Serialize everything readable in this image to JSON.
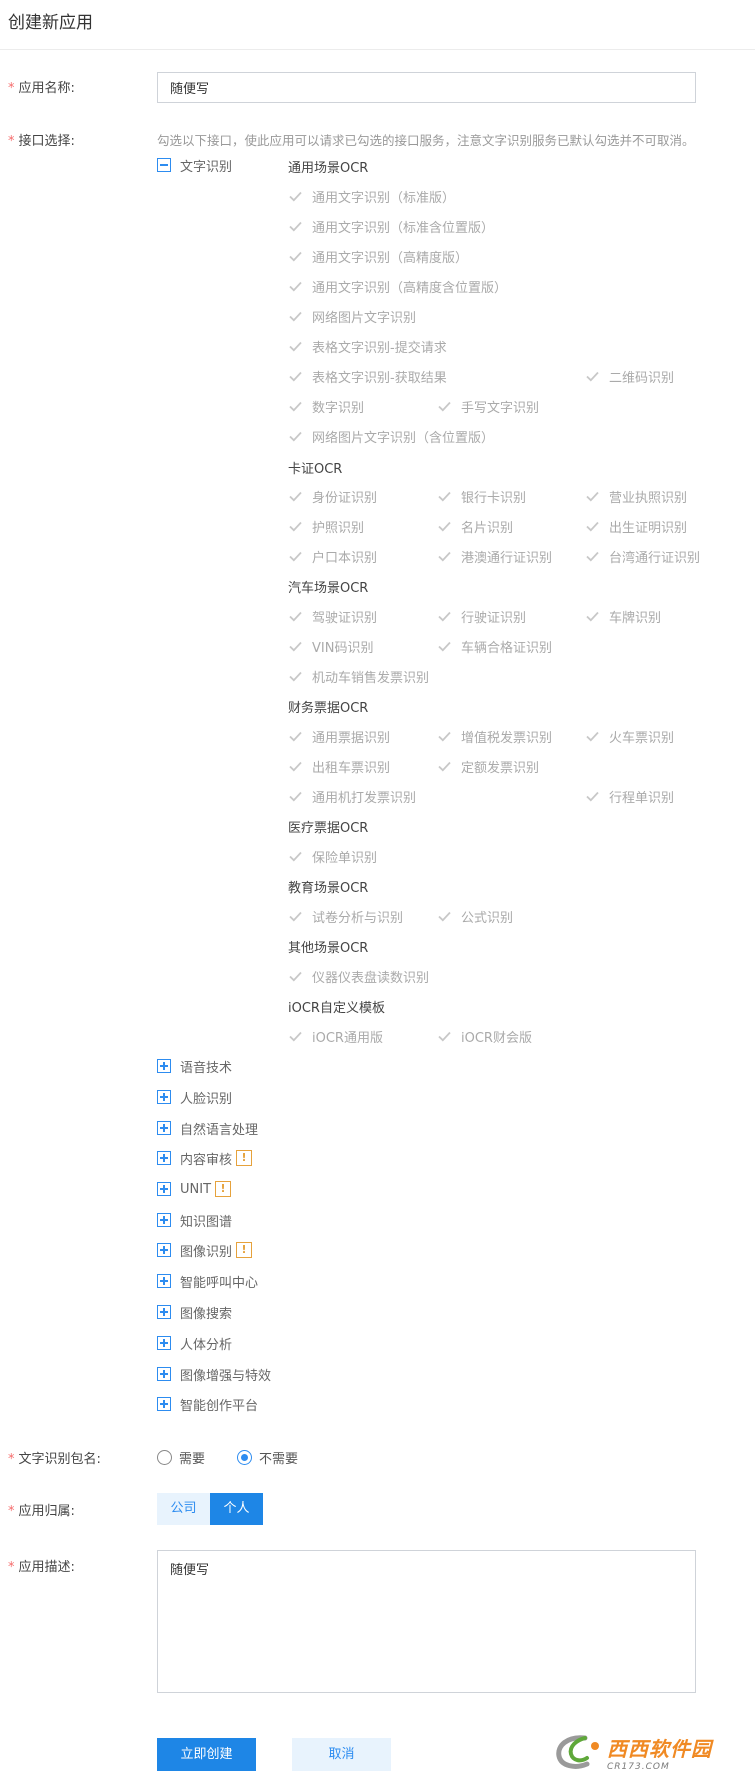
{
  "page": {
    "title": "创建新应用"
  },
  "form": {
    "app_name_label": "应用名称:",
    "app_name_value": "随便写",
    "api_label": "接口选择:",
    "api_hint": "勾选以下接口，使此应用可以请求已勾选的接口服务，注意文字识别服务已默认勾选并不可取消。",
    "package_label": "文字识别包名:",
    "owner_label": "应用归属:",
    "desc_label": "应用描述:",
    "desc_value": "随便写",
    "required_mark": "*"
  },
  "ocr": {
    "label": "文字识别",
    "groups": [
      {
        "title": "通用场景OCR"
      },
      {
        "title": "卡证OCR"
      },
      {
        "title": "汽车场景OCR"
      },
      {
        "title": "财务票据OCR"
      },
      {
        "title": "医疗票据OCR"
      },
      {
        "title": "教育场景OCR"
      },
      {
        "title": "其他场景OCR"
      },
      {
        "title": "iOCR自定义模板"
      }
    ],
    "items": [
      "通用文字识别（标准版）",
      "通用文字识别（标准含位置版）",
      "通用文字识别（高精度版）",
      "通用文字识别（高精度含位置版）",
      "网络图片文字识别",
      "表格文字识别-提交请求",
      "表格文字识别-获取结果",
      "二维码识别",
      "数字识别",
      "手写文字识别",
      "网络图片文字识别（含位置版）",
      "身份证识别",
      "银行卡识别",
      "营业执照识别",
      "护照识别",
      "名片识别",
      "出生证明识别",
      "户口本识别",
      "港澳通行证识别",
      "台湾通行证识别",
      "驾驶证识别",
      "行驶证识别",
      "车牌识别",
      "VIN码识别",
      "车辆合格证识别",
      "机动车销售发票识别",
      "通用票据识别",
      "增值税发票识别",
      "火车票识别",
      "出租车票识别",
      "定额发票识别",
      "通用机打发票识别",
      "行程单识别",
      "保险单识别",
      "试卷分析与识别",
      "公式识别",
      "仪器仪表盘读数识别",
      "iOCR通用版",
      "iOCR财会版"
    ]
  },
  "services": [
    "语音技术",
    "人脸识别",
    "自然语言处理",
    "内容审核",
    "UNIT",
    "知识图谱",
    "图像识别",
    "智能呼叫中心",
    "图像搜索",
    "人体分析",
    "图像增强与特效",
    "智能创作平台"
  ],
  "warn_glyph": "!",
  "package": {
    "options": [
      "需要",
      "不需要"
    ],
    "selected": "不需要"
  },
  "owner": {
    "options": [
      "公司",
      "个人"
    ],
    "selected": "个人"
  },
  "buttons": {
    "create": "立即创建",
    "cancel": "取消"
  },
  "watermark": {
    "main": "西西软件园",
    "sub": "CR173.COM"
  },
  "colors": {
    "accent": "#1e86e6",
    "required": "#f56c6c",
    "warning": "#e6a23c",
    "check": "#c8c8c8"
  }
}
